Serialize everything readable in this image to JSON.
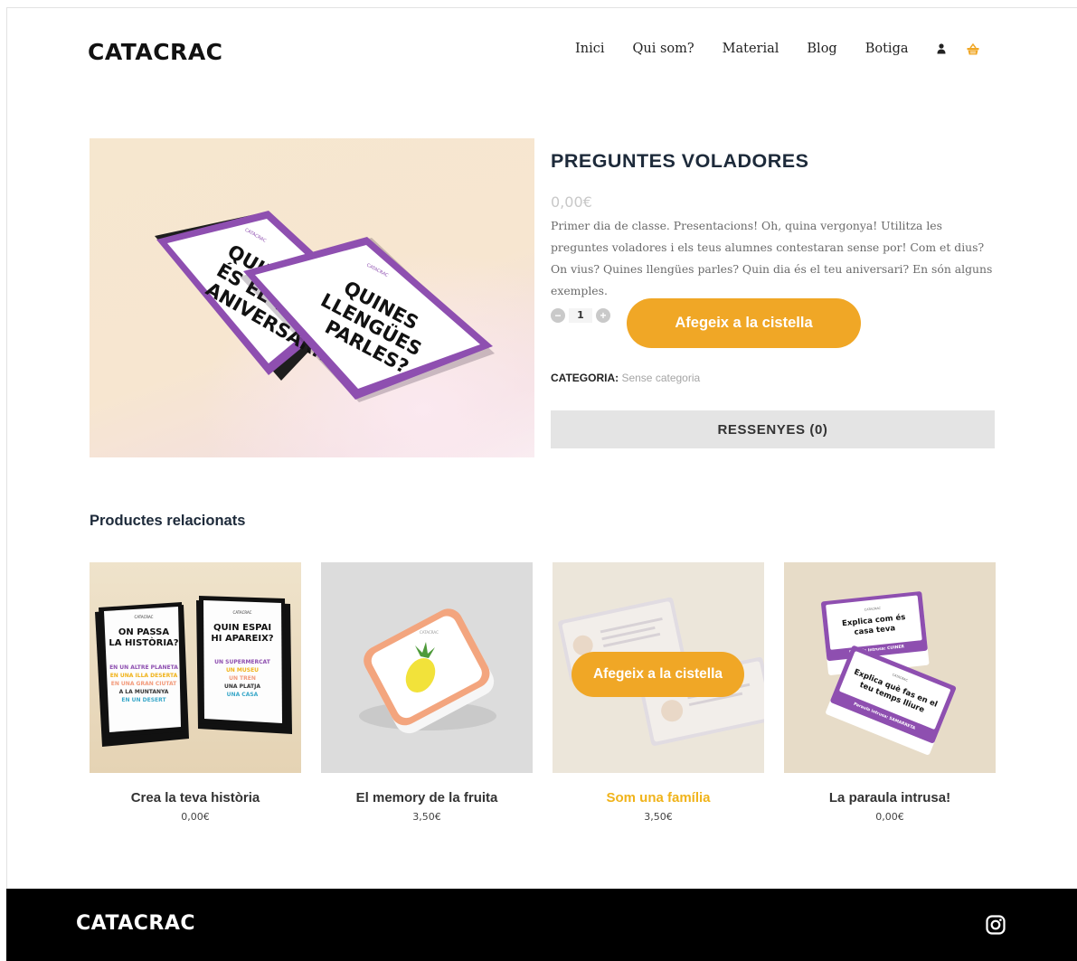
{
  "header": {
    "logo": "CATACRAC",
    "nav": [
      "Inici",
      "Qui som?",
      "Material",
      "Blog",
      "Botiga"
    ],
    "icons": [
      "user-icon",
      "basket-icon"
    ],
    "basket_color": "#f0a726"
  },
  "product": {
    "title": "PREGUNTES VOLADORES",
    "price": "0,00€",
    "description": "Primer dia de classe. Presentacions! Oh, quina vergonya! Utilitza les preguntes voladores i els teus alumnes contestaran sense por! Com et dius? On vius? Quines llengües parles? Quin dia és el teu aniversari? En són alguns exemples.",
    "quantity": "1",
    "add_to_cart": "Afegeix a la cistella",
    "category_label": "CATEGORIA:",
    "category_value": "Sense categoria",
    "reviews_tab": "RESSENYES (0)",
    "image": {
      "back_card": {
        "brand": "CATACRAC",
        "text": "QUIN DIA ÉS EL TEU ANIVERSARI?"
      },
      "front_card": {
        "brand": "CATACRAC",
        "lines": [
          "QUINES",
          "LLENGÜES",
          "PARLES?"
        ]
      },
      "accent": "#8e4fb0"
    }
  },
  "related": {
    "heading": "Productes relacionats",
    "hover_button": "Afegeix a la cistella",
    "items": [
      {
        "name": "Crea la teva història",
        "price": "0,00€",
        "img": {
          "left_title": [
            "ON PASSA",
            "LA HISTÒRIA?"
          ],
          "left_items": [
            "EN UN ALTRE PLANETA",
            "EN UNA ILLA DESERTA",
            "EN UNA GRAN CIUTAT",
            "A LA MUNTANYA",
            "EN UN DESERT"
          ],
          "right_title": [
            "QUIN ESPAI",
            "HI APAREIX?"
          ],
          "right_items": [
            "UN SUPERMERCAT",
            "UN MUSEU",
            "UN TREN",
            "UNA PLATJA",
            "UNA CASA"
          ]
        }
      },
      {
        "name": "El memory de la fruita",
        "price": "3,50€",
        "img": {
          "brand": "CATACRAC"
        }
      },
      {
        "name": "Som una família",
        "price": "3,50€"
      },
      {
        "name": "La paraula intrusa!",
        "price": "0,00€",
        "img": {
          "card1": [
            "Explica com és",
            "casa teva"
          ],
          "card1_hint": "Paraula intrusa: CUINER",
          "card2": [
            "Explica què fas en el",
            "teu temps lliure"
          ],
          "card2_hint": "Paraula intrusa: SAMARRETA"
        }
      }
    ]
  },
  "footer": {
    "logo": "CATACRAC",
    "icons": [
      "instagram-icon"
    ]
  }
}
